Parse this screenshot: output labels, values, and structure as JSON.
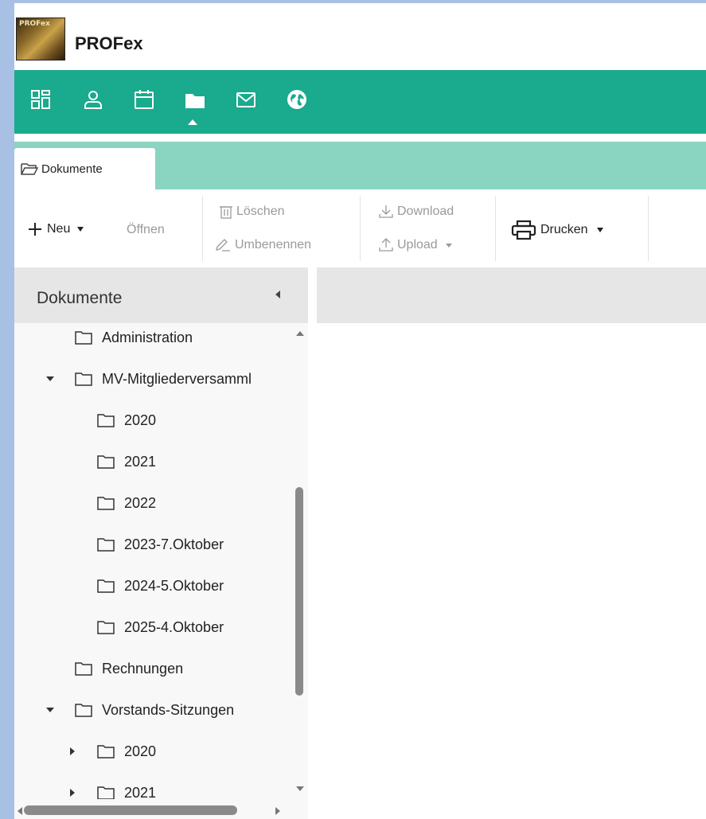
{
  "app": {
    "title": "PROFex",
    "logo_text": "PROFex"
  },
  "nav": {
    "items": [
      {
        "name": "dashboard",
        "icon": "dashboard-icon"
      },
      {
        "name": "contacts",
        "icon": "person-icon"
      },
      {
        "name": "calendar",
        "icon": "calendar-icon"
      },
      {
        "name": "documents",
        "icon": "folder-icon",
        "active": true
      },
      {
        "name": "mail",
        "icon": "mail-icon"
      },
      {
        "name": "web",
        "icon": "globe-icon"
      }
    ]
  },
  "tabs": [
    {
      "label": "Dokumente",
      "icon": "folder-open-icon",
      "active": true
    }
  ],
  "toolbar": {
    "new_label": "Neu",
    "open_label": "Öffnen",
    "delete_label": "Löschen",
    "rename_label": "Umbenennen",
    "download_label": "Download",
    "upload_label": "Upload",
    "print_label": "Drucken"
  },
  "panel": {
    "title": "Dokumente"
  },
  "tree": [
    {
      "label": "Administration",
      "expander": "none"
    },
    {
      "label": "MV-Mitgliederversamml",
      "expander": "expanded"
    },
    {
      "label": "2020",
      "expander": "none"
    },
    {
      "label": "2021",
      "expander": "none"
    },
    {
      "label": "2022",
      "expander": "none"
    },
    {
      "label": "2023-7.Oktober",
      "expander": "none"
    },
    {
      "label": "2024-5.Oktober",
      "expander": "none"
    },
    {
      "label": "2025-4.Oktober",
      "expander": "none"
    },
    {
      "label": "Rechnungen",
      "expander": "none"
    },
    {
      "label": "Vorstands-Sitzungen",
      "expander": "expanded"
    },
    {
      "label": "2020",
      "expander": "collapsed"
    },
    {
      "label": "2021",
      "expander": "collapsed"
    }
  ],
  "colors": {
    "accent": "#1aaa8e",
    "tab_strip": "#8ad4c2",
    "frame": "#a8c0e4"
  }
}
